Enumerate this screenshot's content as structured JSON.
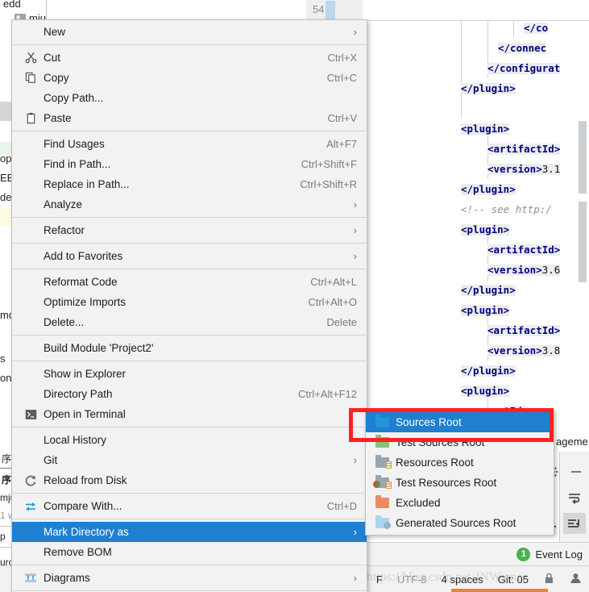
{
  "app": {
    "context_menu": {
      "groups": [
        [
          {
            "label": "New",
            "accel": "",
            "submenu": true,
            "icon": ""
          }
        ],
        [
          {
            "label": "Cut",
            "accel": "Ctrl+X",
            "submenu": false,
            "icon": "scissors-icon"
          },
          {
            "label": "Copy",
            "accel": "Ctrl+C",
            "submenu": false,
            "icon": "copy-icon"
          },
          {
            "label": "Copy Path...",
            "accel": "",
            "submenu": false,
            "icon": ""
          },
          {
            "label": "Paste",
            "accel": "Ctrl+V",
            "submenu": false,
            "icon": "clipboard-icon"
          }
        ],
        [
          {
            "label": "Find Usages",
            "accel": "Alt+F7",
            "submenu": false,
            "icon": ""
          },
          {
            "label": "Find in Path...",
            "accel": "Ctrl+Shift+F",
            "submenu": false,
            "icon": ""
          },
          {
            "label": "Replace in Path...",
            "accel": "Ctrl+Shift+R",
            "submenu": false,
            "icon": ""
          },
          {
            "label": "Analyze",
            "accel": "",
            "submenu": true,
            "icon": ""
          }
        ],
        [
          {
            "label": "Refactor",
            "accel": "",
            "submenu": true,
            "icon": ""
          }
        ],
        [
          {
            "label": "Add to Favorites",
            "accel": "",
            "submenu": true,
            "icon": ""
          }
        ],
        [
          {
            "label": "Reformat Code",
            "accel": "Ctrl+Alt+L",
            "submenu": false,
            "icon": ""
          },
          {
            "label": "Optimize Imports",
            "accel": "Ctrl+Alt+O",
            "submenu": false,
            "icon": ""
          },
          {
            "label": "Delete...",
            "accel": "Delete",
            "submenu": false,
            "icon": ""
          }
        ],
        [
          {
            "label": "Build Module 'Project2'",
            "accel": "",
            "submenu": false,
            "icon": ""
          }
        ],
        [
          {
            "label": "Show in Explorer",
            "accel": "",
            "submenu": false,
            "icon": ""
          },
          {
            "label": "Directory Path",
            "accel": "Ctrl+Alt+F12",
            "submenu": false,
            "icon": ""
          },
          {
            "label": "Open in Terminal",
            "accel": "",
            "submenu": false,
            "icon": "terminal-icon"
          }
        ],
        [
          {
            "label": "Local History",
            "accel": "",
            "submenu": false,
            "icon": ""
          },
          {
            "label": "Git",
            "accel": "",
            "submenu": true,
            "icon": ""
          },
          {
            "label": "Reload from Disk",
            "accel": "",
            "submenu": false,
            "icon": "refresh-icon"
          }
        ],
        [
          {
            "label": "Compare With...",
            "accel": "Ctrl+D",
            "submenu": false,
            "icon": "compare-icon"
          }
        ],
        [
          {
            "label": "Mark Directory as",
            "accel": "",
            "submenu": true,
            "icon": "",
            "selected": true
          },
          {
            "label": "Remove BOM",
            "accel": "",
            "submenu": false,
            "icon": ""
          }
        ],
        [
          {
            "label": "Diagrams",
            "accel": "",
            "submenu": true,
            "icon": "diagram-icon"
          }
        ]
      ]
    },
    "submenu": {
      "title": "Mark Directory as",
      "items": [
        {
          "label": "Sources Root",
          "icon": "folder-blue-icon",
          "selected": true
        },
        {
          "label": "Test Sources Root",
          "icon": "folder-green-icon",
          "selected": false
        },
        {
          "label": "Resources Root",
          "icon": "folder-resources-icon",
          "selected": false
        },
        {
          "label": "Test Resources Root",
          "icon": "folder-test-resources-icon",
          "selected": false
        },
        {
          "label": "Excluded",
          "icon": "folder-orange-icon",
          "selected": false
        },
        {
          "label": "Generated Sources Root",
          "icon": "folder-generated-icon",
          "selected": false
        }
      ]
    },
    "project_tree": {
      "rows": [
        {
          "text": "edd",
          "icon": "",
          "state": "partial"
        },
        {
          "text": "miu",
          "icon": "folder-icon",
          "state": "normal"
        },
        {
          "text": "",
          "icon": "chevron-down-icon",
          "state": "normal"
        },
        {
          "text": "op",
          "icon": "",
          "state": "green"
        },
        {
          "text": "EB-",
          "icon": "",
          "state": "normal"
        },
        {
          "text": "dex",
          "icon": "",
          "state": "normal"
        },
        {
          "text": "",
          "icon": "",
          "state": "yellow"
        },
        {
          "text": "md",
          "icon": "",
          "state": "normal"
        },
        {
          "text": "s",
          "icon": "",
          "state": "normal"
        },
        {
          "text": "ons",
          "icon": "",
          "state": "normal"
        }
      ],
      "line_number_label": "54"
    },
    "editor": {
      "lines": [
        {
          "indent": 7,
          "text": "</co",
          "kind": "tag"
        },
        {
          "indent": 5,
          "text": "</connec",
          "kind": "tag"
        },
        {
          "indent": 3,
          "text": "</configurat",
          "kind": "tag"
        },
        {
          "indent": 1,
          "text": "</plugin>",
          "kind": "tag"
        },
        {
          "indent": 1,
          "text": "<plugin>",
          "kind": "tag"
        },
        {
          "indent": 3,
          "text": "<artifactId>",
          "kind": "tag"
        },
        {
          "indent": 3,
          "text": "<version>",
          "value": "3.1",
          "kind": "tag"
        },
        {
          "indent": 1,
          "text": "</plugin>",
          "kind": "tag"
        },
        {
          "indent": 1,
          "text": "<!-- see http:/",
          "kind": "comment"
        },
        {
          "indent": 1,
          "text": "<plugin>",
          "kind": "tag"
        },
        {
          "indent": 3,
          "text": "<artifactId>",
          "kind": "tag"
        },
        {
          "indent": 3,
          "text": "<version>",
          "value": "3.6",
          "kind": "tag"
        },
        {
          "indent": 1,
          "text": "</plugin>",
          "kind": "tag"
        },
        {
          "indent": 1,
          "text": "<plugin>",
          "kind": "tag"
        },
        {
          "indent": 3,
          "text": "<artifactId>",
          "kind": "tag"
        },
        {
          "indent": 3,
          "text": "<version>",
          "value": "3.8",
          "kind": "tag"
        },
        {
          "indent": 1,
          "text": "</plugin>",
          "kind": "tag"
        },
        {
          "indent": 1,
          "text": "<plugin>",
          "kind": "tag"
        },
        {
          "indent": 3,
          "text": "tId>",
          "kind": "tag"
        }
      ],
      "tail_text": "ageme"
    },
    "right_panel": {
      "fragment_top": "p",
      "fragment_bottom": "ir",
      "icons": [
        "gear-icon",
        "minimize-icon",
        "soft-wrap-icon",
        "sort-icon"
      ]
    },
    "event_log": {
      "count": "1",
      "label": "Event Log"
    },
    "status_bar": {
      "left_fragment": "urc",
      "items": [
        "F",
        "UTF-8",
        "4 spaces",
        "Git: 05"
      ],
      "icons": [
        "lock-icon",
        "person-icon"
      ]
    },
    "watermark": "https://blog.csdn.net/JNWerner",
    "left_fragments": [
      {
        "text": "序",
        "bold": false
      },
      {
        "text": "序:",
        "bold": true
      },
      {
        "text": "mju",
        "bold": false
      },
      {
        "text": "1 w",
        "bold": false,
        "muted": true
      },
      {
        "text": "p",
        "bold": false
      },
      {
        "text": "urc",
        "bold": false
      }
    ]
  },
  "colors": {
    "menu_bg": "#f2f2f2",
    "menu_border": "#c2c2c2",
    "selection": "#1f7fd0",
    "annotation_red": "#ff2020",
    "accel_text": "#7b7b7b",
    "code_tag": "#000080",
    "comment": "#909090",
    "badge_green": "#4caf50"
  }
}
